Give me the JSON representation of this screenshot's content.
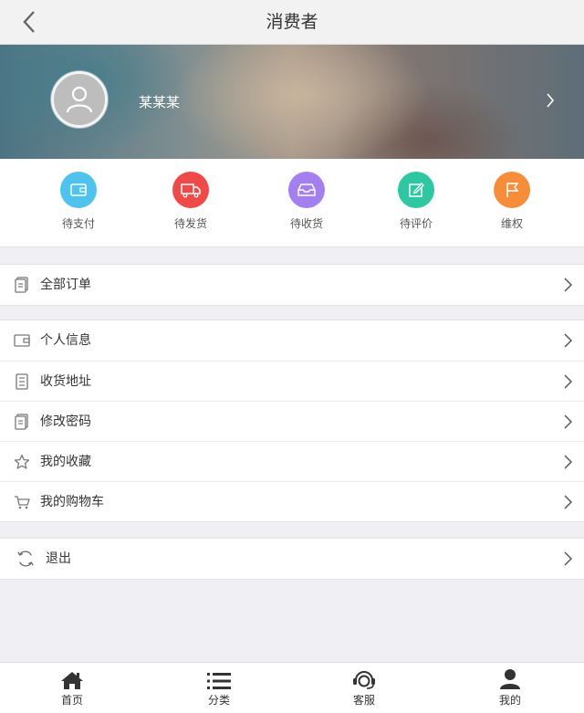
{
  "header": {
    "title": "消费者"
  },
  "profile": {
    "name": "某某某"
  },
  "order_status": [
    {
      "label": "待支付",
      "color": "#4fc3ee",
      "icon": "wallet-icon"
    },
    {
      "label": "待发货",
      "color": "#ee4a48",
      "icon": "truck-icon"
    },
    {
      "label": "待收货",
      "color": "#a37ff0",
      "icon": "inbox-icon"
    },
    {
      "label": "待评价",
      "color": "#2ec7a1",
      "icon": "edit-icon"
    },
    {
      "label": "维权",
      "color": "#f68d3a",
      "icon": "flag-icon"
    }
  ],
  "menu": {
    "all_orders": {
      "label": "全部订单",
      "icon": "document-icon"
    },
    "items": [
      {
        "label": "个人信息",
        "icon": "wallet-icon"
      },
      {
        "label": "收货地址",
        "icon": "list-icon"
      },
      {
        "label": "修改密码",
        "icon": "document-icon"
      },
      {
        "label": "我的收藏",
        "icon": "star-icon"
      },
      {
        "label": "我的购物车",
        "icon": "cart-icon"
      }
    ],
    "logout": {
      "label": "退出",
      "icon": "refresh-icon"
    }
  },
  "tabbar": [
    {
      "label": "首页",
      "icon": "home-icon"
    },
    {
      "label": "分类",
      "icon": "list-icon"
    },
    {
      "label": "客服",
      "icon": "headset-icon"
    },
    {
      "label": "我的",
      "icon": "user-icon"
    }
  ]
}
